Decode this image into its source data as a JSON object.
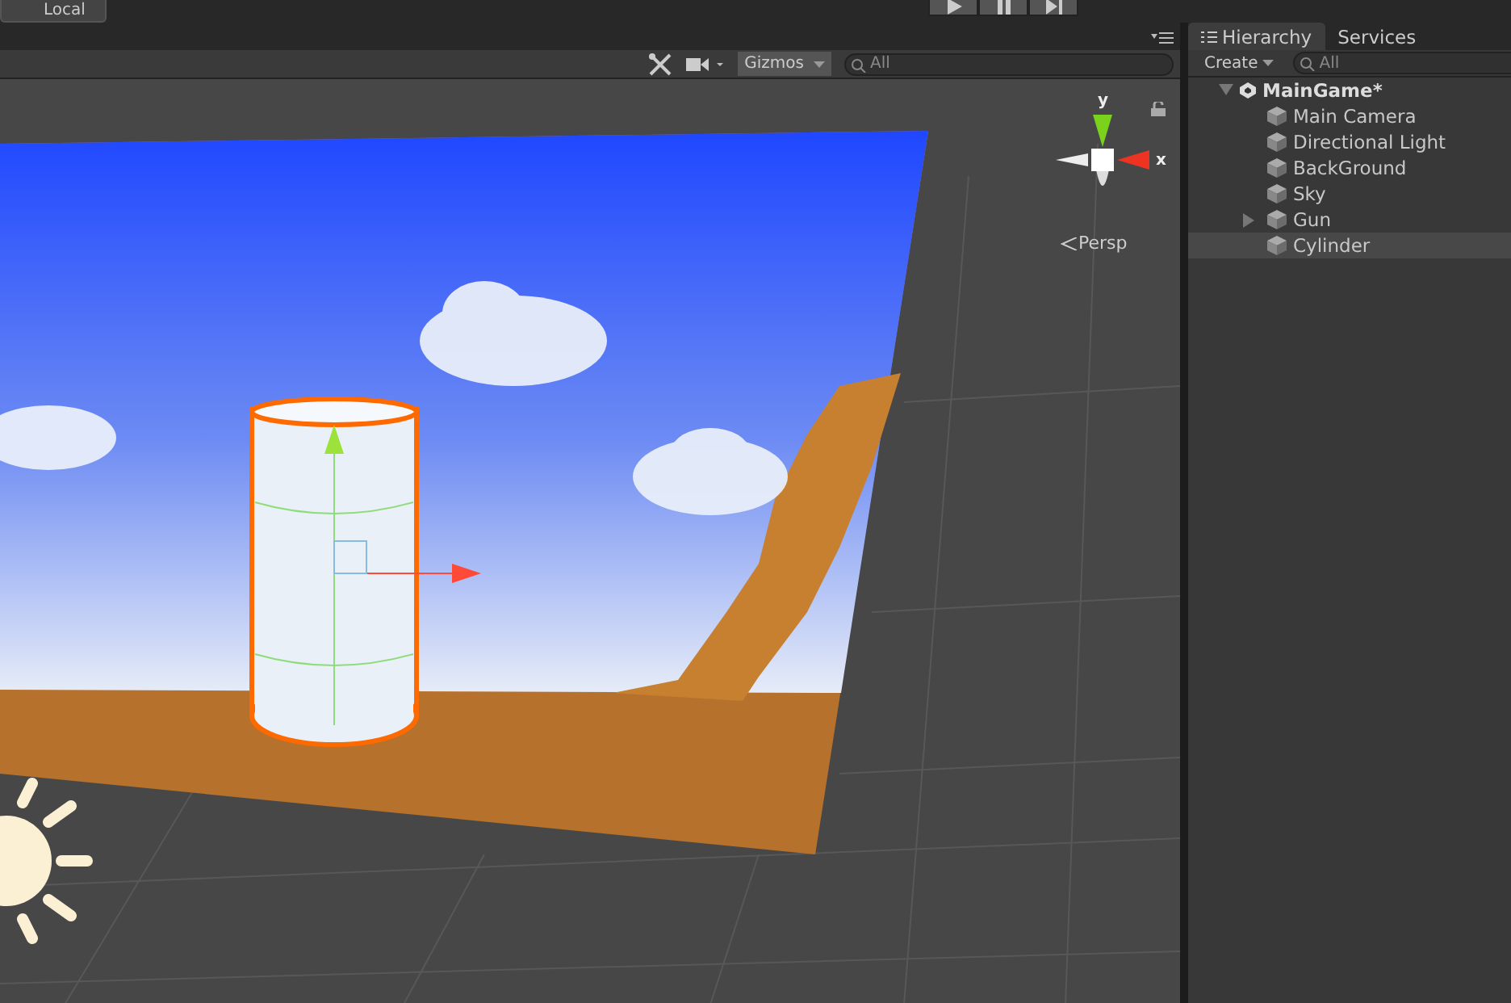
{
  "main_toolbar": {
    "pivot_button": "Local"
  },
  "scene_toolbar": {
    "gizmos_label": "Gizmos",
    "search": {
      "placeholder": "All"
    }
  },
  "scene_view": {
    "axis_y": "y",
    "axis_x": "x",
    "projection": "Persp"
  },
  "hierarchy": {
    "tabs": [
      {
        "label": "Hierarchy",
        "selected": true
      },
      {
        "label": "Services",
        "selected": false
      }
    ],
    "create_button": "Create",
    "search": {
      "placeholder": "All"
    },
    "root": {
      "label": "MainGame*",
      "expanded": true,
      "children": [
        {
          "label": "Main Camera",
          "expandable": false,
          "selected": false
        },
        {
          "label": "Directional Light",
          "expandable": false,
          "selected": false
        },
        {
          "label": "BackGround",
          "expandable": false,
          "selected": false
        },
        {
          "label": "Sky",
          "expandable": false,
          "selected": false
        },
        {
          "label": "Gun",
          "expandable": true,
          "selected": false
        },
        {
          "label": "Cylinder",
          "expandable": false,
          "selected": true
        }
      ]
    }
  }
}
